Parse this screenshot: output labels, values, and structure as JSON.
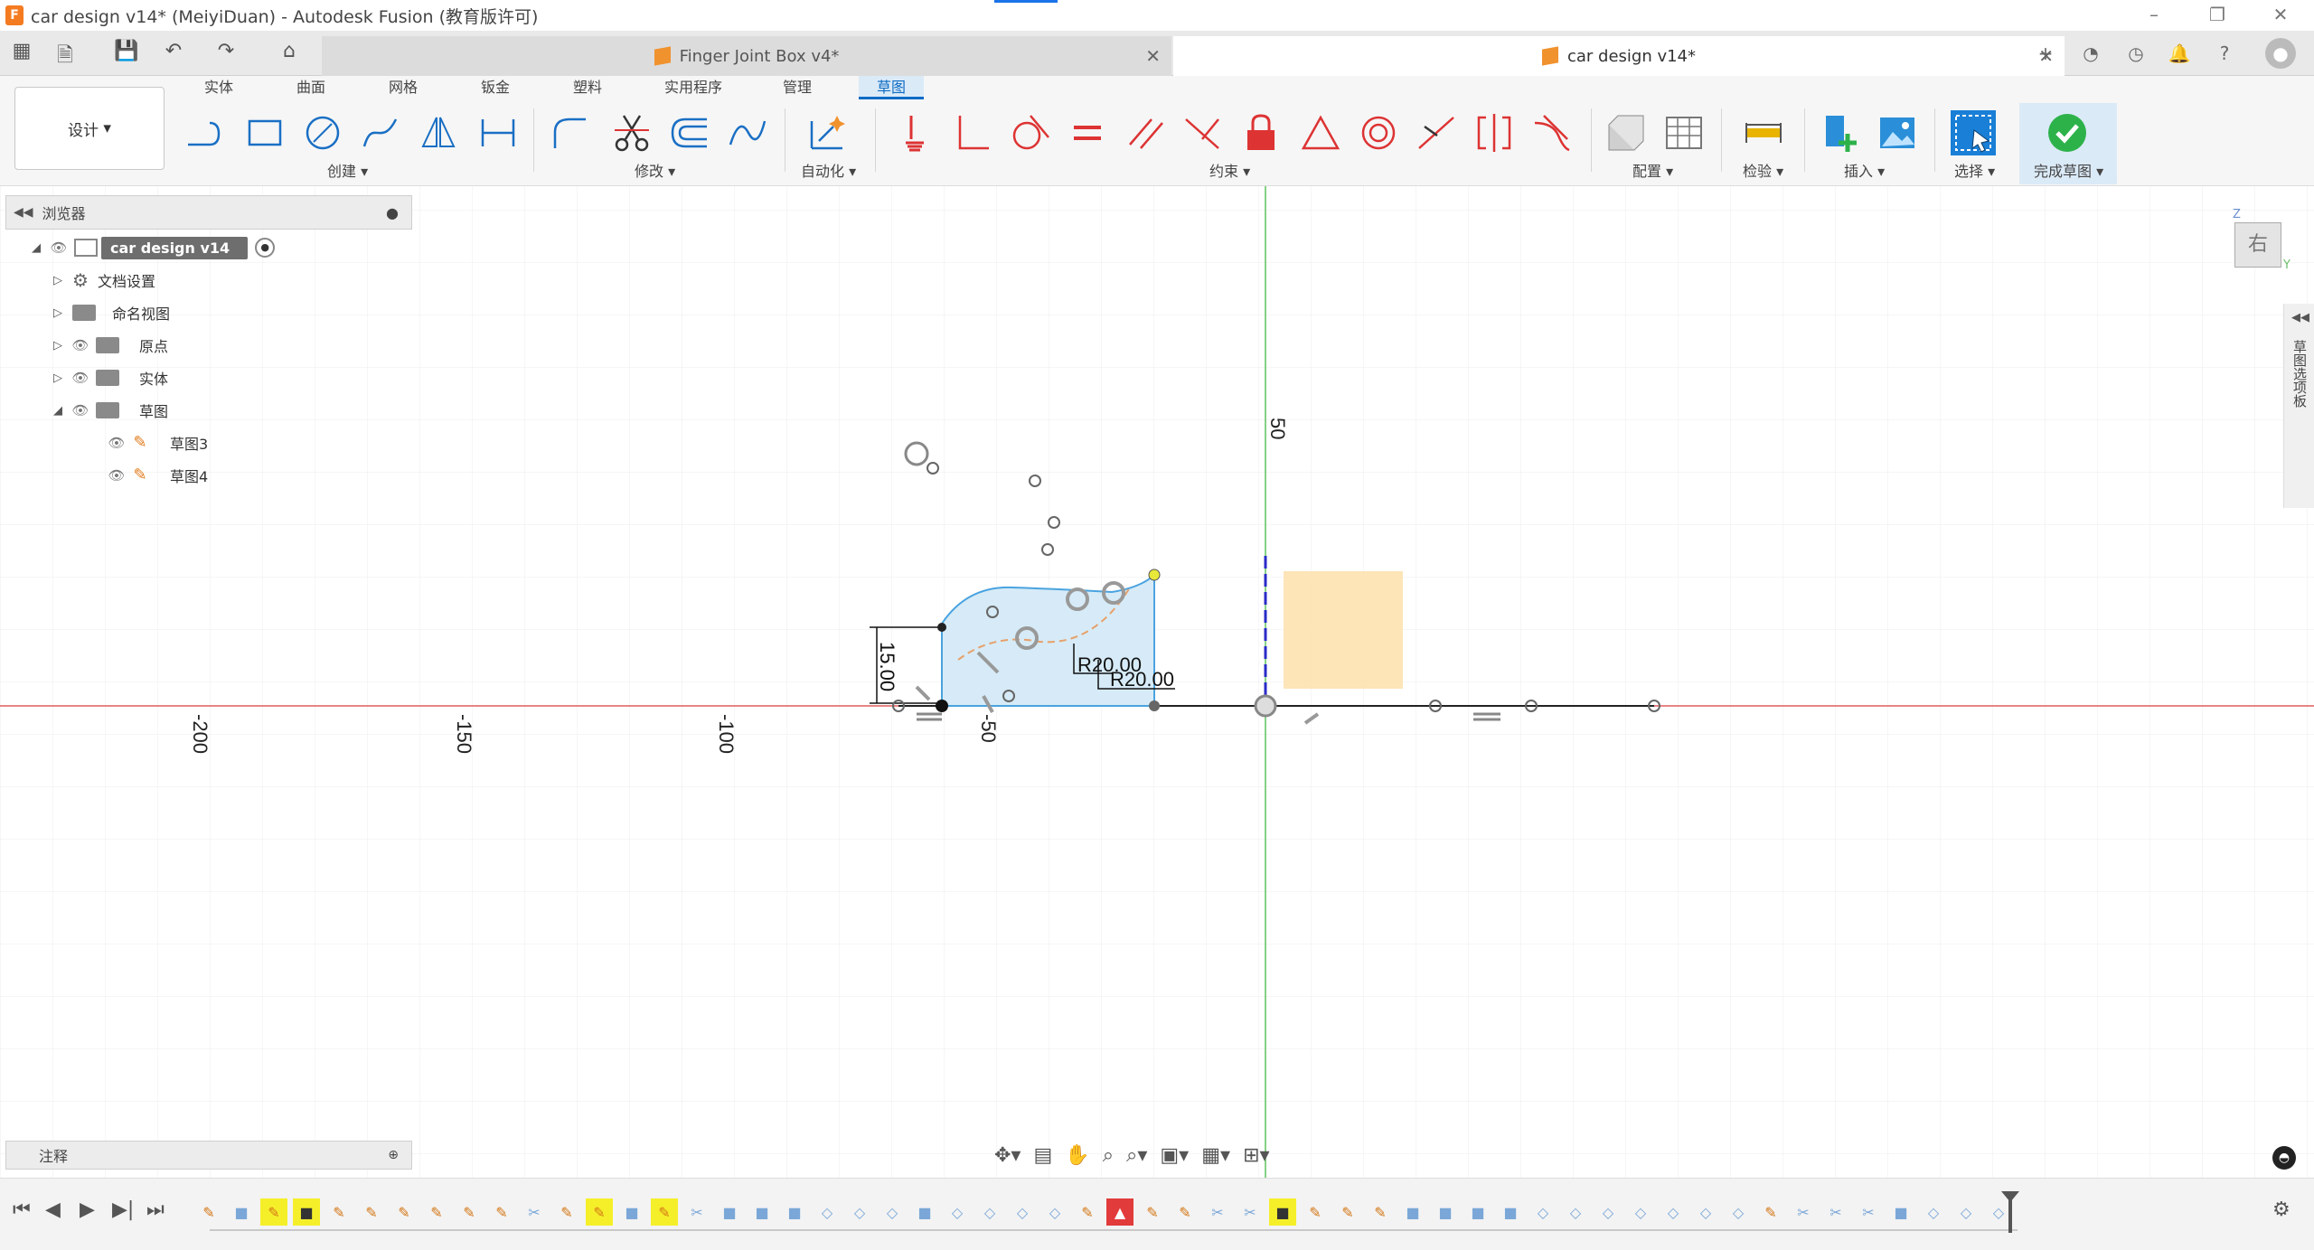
{
  "window": {
    "title": "car design v14* (MeiyiDuan) - Autodesk Fusion (教育版许可)",
    "app_badge": "F"
  },
  "tabs": [
    {
      "label": "Finger Joint Box v4*",
      "active": false
    },
    {
      "label": "car design v14*",
      "active": true
    }
  ],
  "ribbon": {
    "workspace": "设计",
    "tabs": [
      "实体",
      "曲面",
      "网格",
      "钣金",
      "塑料",
      "实用程序",
      "管理",
      "草图"
    ],
    "active_tab": "草图",
    "groups": {
      "create": "创建",
      "modify": "修改",
      "automate": "自动化",
      "constraints": "约束",
      "configure": "配置",
      "inspect": "检验",
      "insert": "插入",
      "select": "选择",
      "finish": "完成草图"
    }
  },
  "browser": {
    "header": "浏览器",
    "root": "car design v14",
    "items": [
      {
        "label": "文档设置",
        "expanded": false
      },
      {
        "label": "命名视图",
        "expanded": false
      },
      {
        "label": "原点",
        "expanded": false
      },
      {
        "label": "实体",
        "expanded": false
      },
      {
        "label": "草图",
        "expanded": true
      }
    ],
    "sketches": [
      "草图3",
      "草图4"
    ]
  },
  "notes_panel": {
    "label": "注释"
  },
  "canvas": {
    "axis_labels": [
      "-200",
      "-150",
      "-100",
      "-50",
      "50"
    ],
    "dimensions": [
      "15.00",
      "R20.00",
      "R20.00"
    ]
  },
  "viewcube": {
    "face": "右",
    "z_label": "Z",
    "y_label": "Y"
  },
  "right_panel": {
    "label": "草图选项板"
  },
  "colors": {
    "accent_blue": "#0b6bc4",
    "x_axis": "#e05c5c",
    "y_axis": "#5cc45c",
    "sketch_profile": "#d6ebf7",
    "selected_body": "#fde2b0",
    "finish_green": "#2db24a",
    "timeline_highlight": "#f5ef2a",
    "timeline_error": "#e23b3b"
  }
}
